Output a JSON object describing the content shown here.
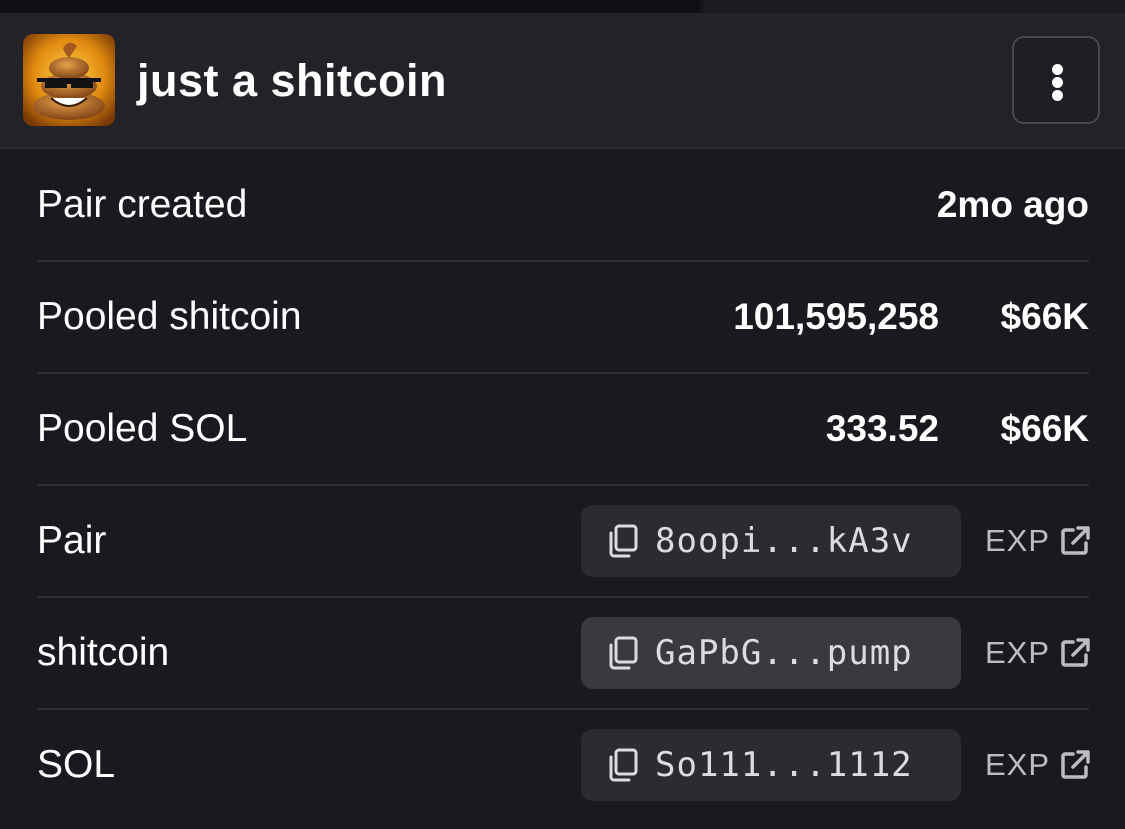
{
  "header": {
    "title": "just a shitcoin",
    "avatar_icon": "poop-with-sunglasses-avatar",
    "menu_icon": "kebab-menu-icon"
  },
  "rows": {
    "pair_created": {
      "label": "Pair created",
      "value": "2mo ago"
    },
    "pooled_token": {
      "label": "Pooled shitcoin",
      "amount": "101,595,258",
      "usd": "$66K"
    },
    "pooled_sol": {
      "label": "Pooled SOL",
      "amount": "333.52",
      "usd": "$66K"
    },
    "pair": {
      "label": "Pair",
      "address": "8oopi...kA3v",
      "explorer": "EXP"
    },
    "token": {
      "label": "shitcoin",
      "address": "GaPbG...pump",
      "explorer": "EXP"
    },
    "sol": {
      "label": "SOL",
      "address": "So111...1112",
      "explorer": "EXP"
    }
  },
  "colors": {
    "background": "#1a191f",
    "header_background": "#232229",
    "address_chip": "#2c2b31",
    "address_chip_hover": "#3a393f",
    "text": "#ffffff",
    "muted_text": "#bdbcc2"
  }
}
